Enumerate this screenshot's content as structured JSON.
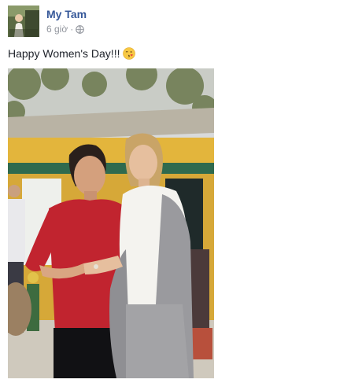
{
  "post": {
    "author_name": "My Tam",
    "timestamp": "6 giờ",
    "separator": "·",
    "privacy_icon": "globe-icon",
    "text": "Happy Women's Day!!!",
    "emoji_icon": "kissing-face-emoji-icon"
  },
  "colors": {
    "author_link": "#365899",
    "meta_text": "#90949c",
    "body_text": "#1d2129"
  }
}
